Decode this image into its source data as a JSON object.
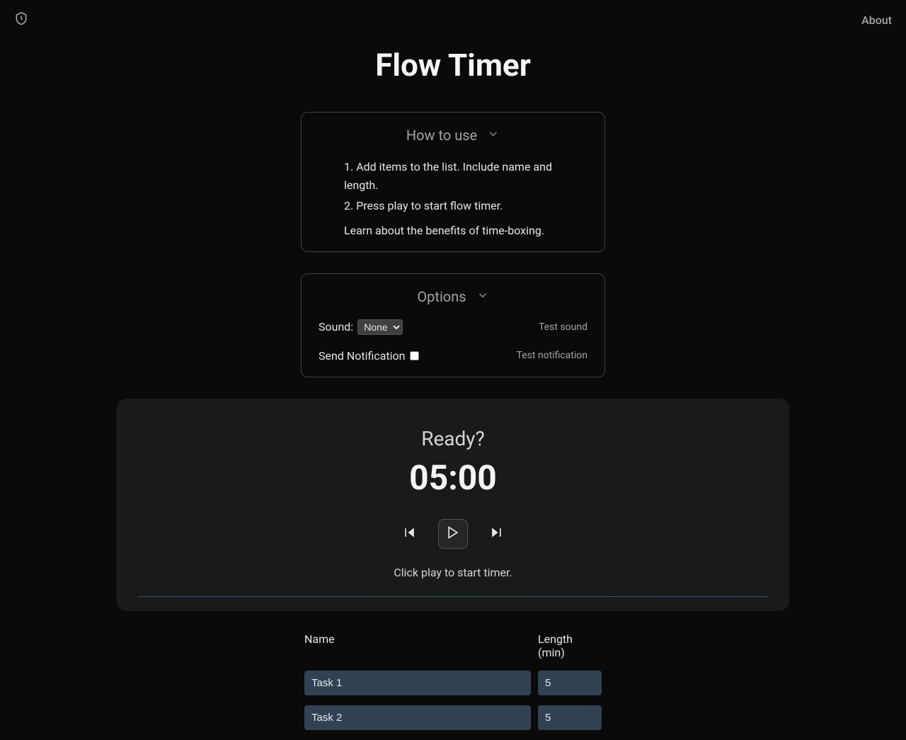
{
  "header": {
    "about_label": "About"
  },
  "title": "Flow Timer",
  "howto": {
    "heading": "How to use",
    "step1": "Add items to the list. Include name and length.",
    "step2": "Press play to start flow timer.",
    "benefits": "Learn about the benefits of time-boxing."
  },
  "options": {
    "heading": "Options",
    "sound_label": "Sound:",
    "sound_value": "None",
    "test_sound": "Test sound",
    "notification_label": "Send Notification",
    "test_notification": "Test notification"
  },
  "timer": {
    "status": "Ready?",
    "display": "05:00",
    "hint": "Click play to start timer."
  },
  "tasks": {
    "name_header": "Name",
    "length_header": "Length (min)",
    "rows": [
      {
        "name": "Task 1",
        "length": "5"
      },
      {
        "name": "Task 2",
        "length": "5"
      }
    ]
  }
}
